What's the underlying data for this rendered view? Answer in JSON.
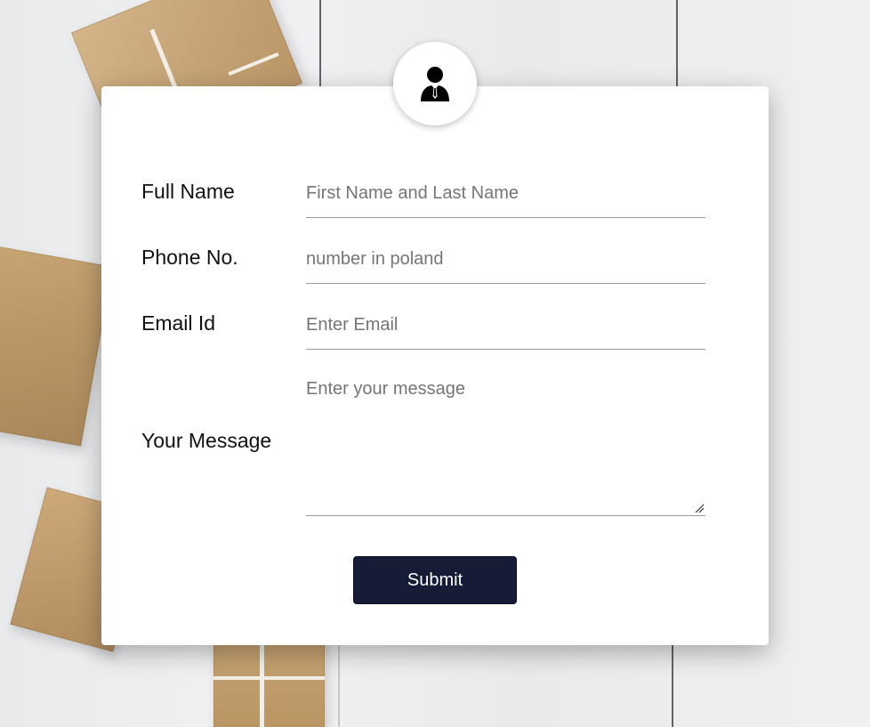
{
  "avatar": {
    "icon": "user-businessman-icon"
  },
  "form": {
    "fields": [
      {
        "label": "Full Name",
        "placeholder": "First Name and Last Name"
      },
      {
        "label": "Phone No.",
        "placeholder": "number in poland"
      },
      {
        "label": "Email Id",
        "placeholder": "Enter Email"
      },
      {
        "label": "Your Message",
        "placeholder": "Enter your message"
      }
    ],
    "submit_label": "Submit"
  },
  "colors": {
    "submit_bg": "#161b36",
    "card_bg": "#ffffff",
    "placeholder": "#757575"
  }
}
